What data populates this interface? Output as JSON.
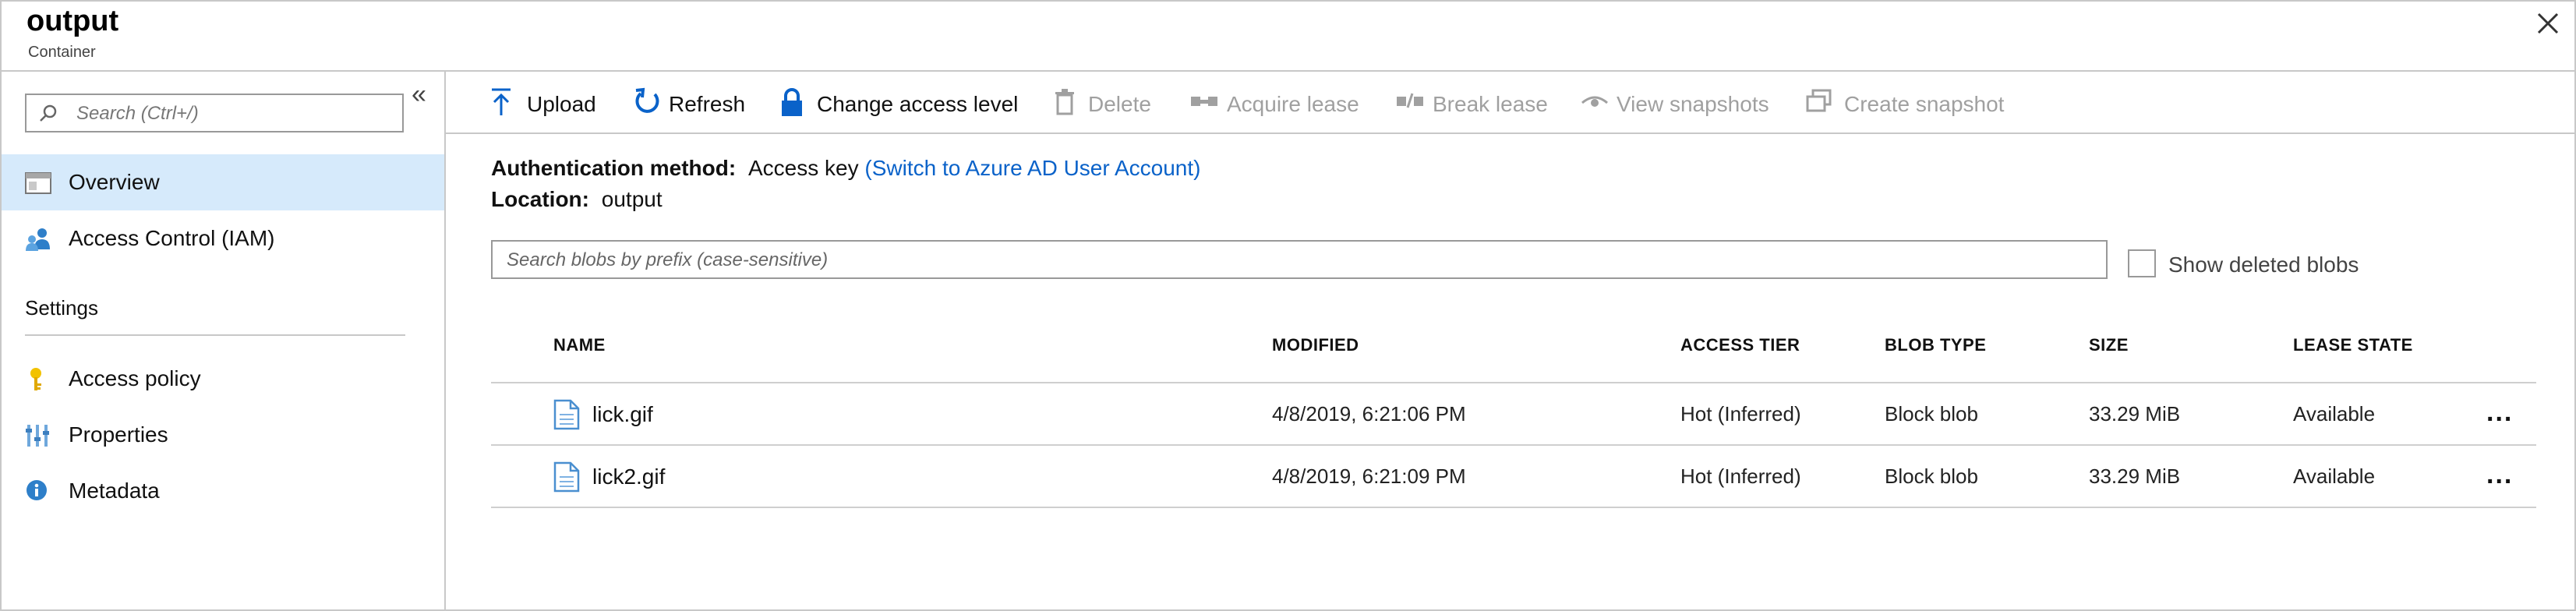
{
  "header": {
    "title": "output",
    "subtitle": "Container"
  },
  "sidebar": {
    "search_placeholder": "Search (Ctrl+/)",
    "items": [
      {
        "label": "Overview",
        "icon": "overview-icon"
      },
      {
        "label": "Access Control (IAM)",
        "icon": "users-icon"
      }
    ],
    "section_title": "Settings",
    "settings_items": [
      {
        "label": "Access policy",
        "icon": "key-icon"
      },
      {
        "label": "Properties",
        "icon": "properties-icon"
      },
      {
        "label": "Metadata",
        "icon": "info-icon"
      }
    ]
  },
  "toolbar": {
    "upload": "Upload",
    "refresh": "Refresh",
    "change_access": "Change access level",
    "delete": "Delete",
    "acquire_lease": "Acquire lease",
    "break_lease": "Break lease",
    "view_snapshots": "View snapshots",
    "create_snapshot": "Create snapshot"
  },
  "info": {
    "auth_label": "Authentication method:",
    "auth_value": "Access key",
    "auth_link": "(Switch to Azure AD User Account)",
    "location_label": "Location:",
    "location_value": "output"
  },
  "blob_search_placeholder": "Search blobs by prefix (case-sensitive)",
  "show_deleted_label": "Show deleted blobs",
  "table": {
    "columns": [
      "NAME",
      "MODIFIED",
      "ACCESS TIER",
      "BLOB TYPE",
      "SIZE",
      "LEASE STATE"
    ],
    "rows": [
      {
        "name": "lick.gif",
        "modified": "4/8/2019, 6:21:06 PM",
        "tier": "Hot (Inferred)",
        "type": "Block blob",
        "size": "33.29 MiB",
        "lease": "Available"
      },
      {
        "name": "lick2.gif",
        "modified": "4/8/2019, 6:21:09 PM",
        "tier": "Hot (Inferred)",
        "type": "Block blob",
        "size": "33.29 MiB",
        "lease": "Available"
      }
    ],
    "more": "..."
  },
  "colors": {
    "accent": "#0a62c9",
    "active_bg": "#d6eafb",
    "disabled": "#a0a0a0"
  }
}
